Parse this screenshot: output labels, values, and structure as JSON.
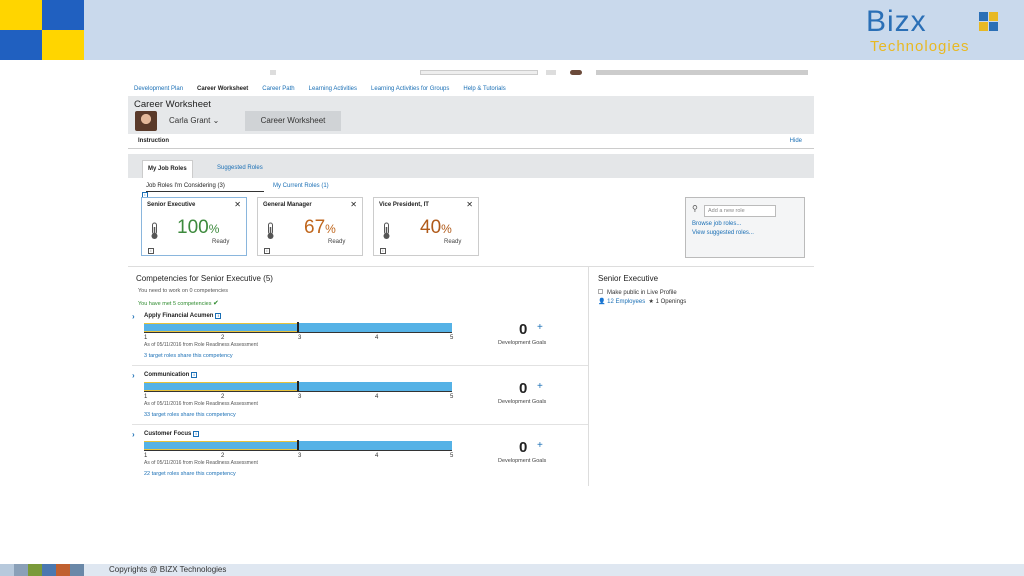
{
  "slide": {
    "brand_line1": "Bizx",
    "brand_line2": "Technologies",
    "footer_text": "Copyrights @ BIZX Technologies",
    "colors": {
      "band": "#c9d9ec",
      "blue": "#2a6fb6",
      "yellow": "#e8b923"
    }
  },
  "nav": {
    "items": [
      "Development Plan",
      "Career Worksheet",
      "Career Path",
      "Learning Activities",
      "Learning Activities for Groups",
      "Help & Tutorials"
    ],
    "active": "Career Worksheet"
  },
  "header": {
    "title": "Career Worksheet",
    "person": "Carla Grant",
    "worksheet_button": "Career Worksheet"
  },
  "instruction": {
    "label": "Instruction",
    "hide": "Hide"
  },
  "tabs": {
    "selected": "My Job Roles",
    "other": "Suggested Roles"
  },
  "subtabs": {
    "considering": "Job Roles I'm Considering (3)",
    "current": "My Current Roles (1)"
  },
  "roles": [
    {
      "name": "Senior Executive",
      "value": "100",
      "unit": "%",
      "status": "Ready",
      "color": "#3d8a3d"
    },
    {
      "name": "General Manager",
      "value": "67",
      "unit": "%",
      "status": "Ready",
      "color": "#c0661c"
    },
    {
      "name": "Vice President, IT",
      "value": "40",
      "unit": "%",
      "status": "Ready",
      "color": "#b05a1a"
    }
  ],
  "add_box": {
    "placeholder": "Add a new role",
    "browse": "Browse job roles...",
    "view": "View suggested roles..."
  },
  "competencies": {
    "title": "Competencies for Senior Executive (5)",
    "need": "You need to work on 0 competencies",
    "met": "You have met 5 competencies",
    "scale": [
      "1",
      "2",
      "3",
      "4",
      "5"
    ],
    "items": [
      {
        "name": "Apply Financial Acumen",
        "level": 3,
        "asof": "As of 05/11/2016 from Role Readiness Assessment",
        "share": "3 target roles share this competency",
        "goals": "0",
        "goals_label": "Development Goals"
      },
      {
        "name": "Communication",
        "level": 3,
        "asof": "As of 05/11/2016 from Role Readiness Assessment",
        "share": "33 target roles share this competency",
        "goals": "0",
        "goals_label": "Development Goals"
      },
      {
        "name": "Customer Focus",
        "level": 3,
        "asof": "As of 05/11/2016 from Role Readiness Assessment",
        "share": "22 target roles share this competency",
        "goals": "0",
        "goals_label": "Development Goals"
      }
    ]
  },
  "side": {
    "title": "Senior Executive",
    "public": "Make public in Live Profile",
    "employees_count": "12",
    "employees_label": "Employees",
    "openings_count": "1",
    "openings_label": "Openings"
  }
}
